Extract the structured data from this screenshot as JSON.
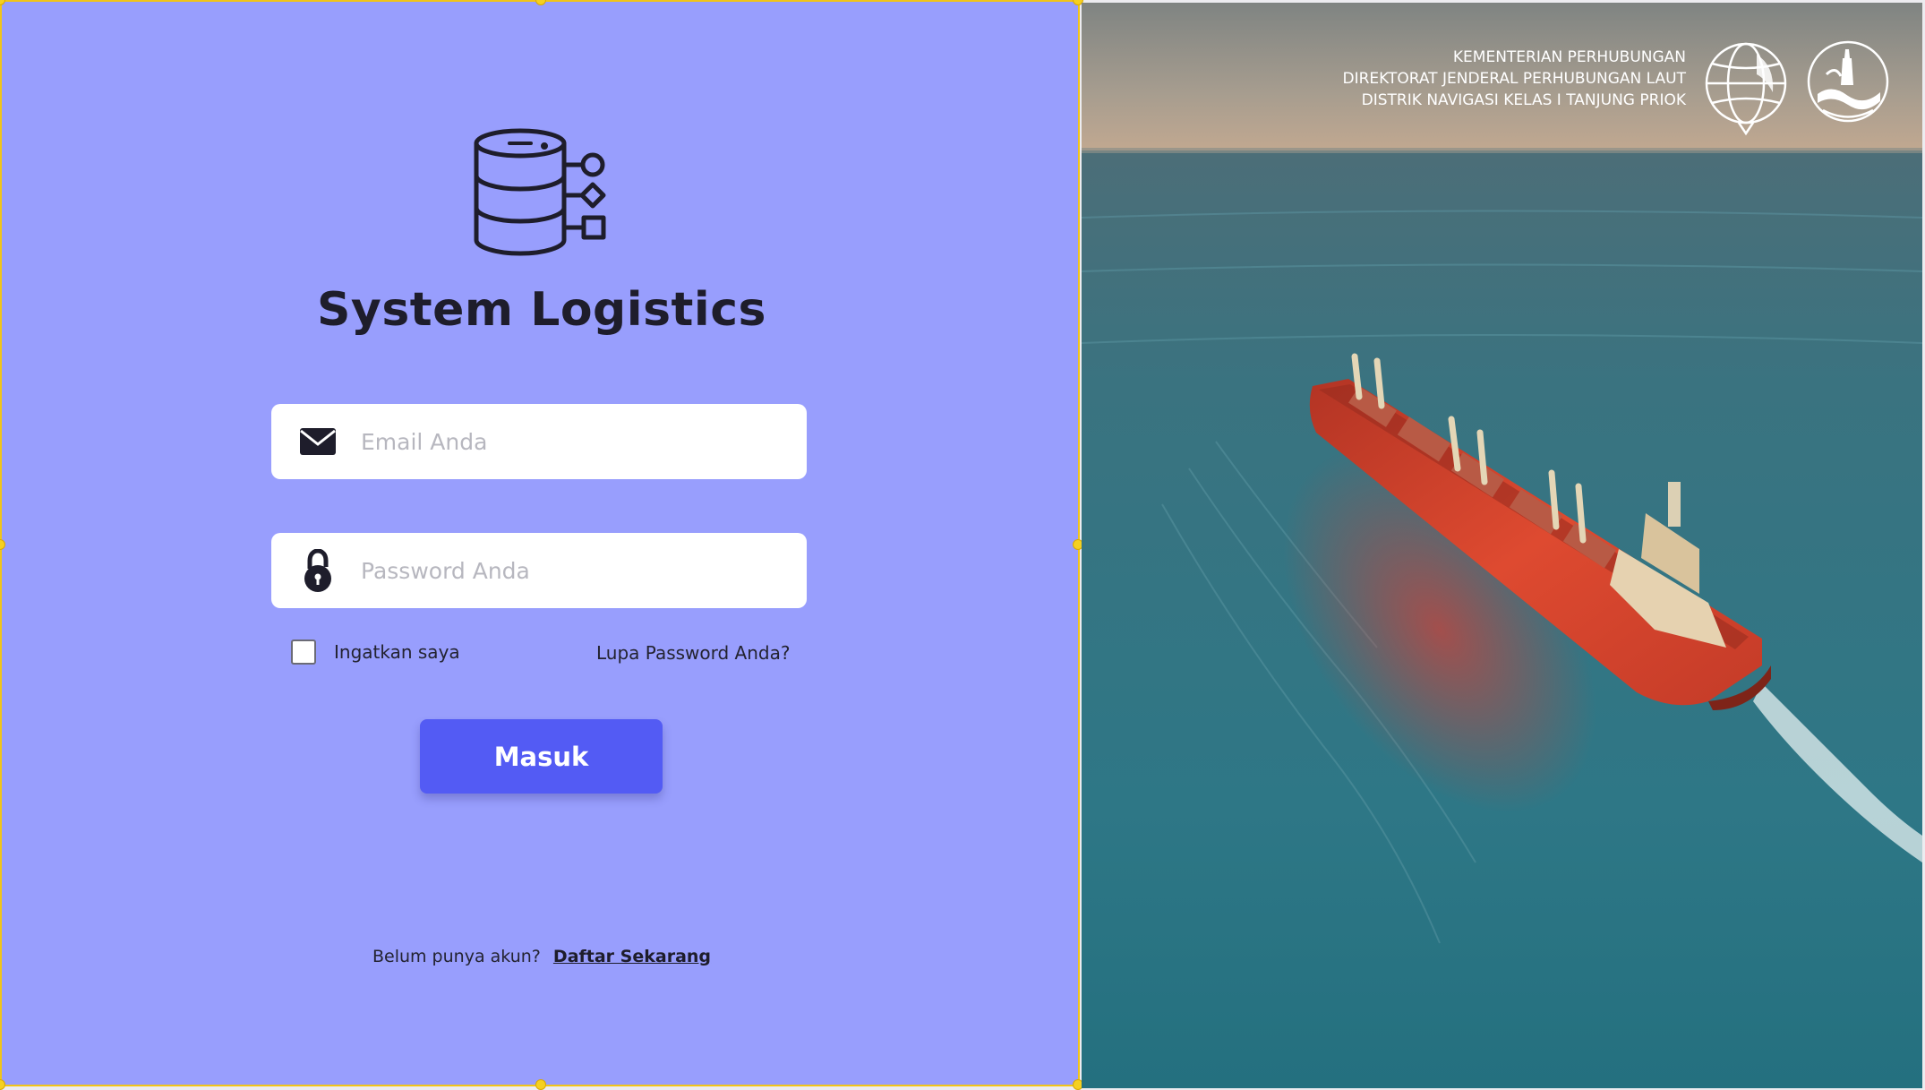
{
  "app": {
    "title": "System Logistics"
  },
  "login": {
    "email_placeholder": "Email Anda",
    "password_placeholder": "Password Anda",
    "remember_label": "Ingatkan saya",
    "forgot_label": "Lupa Password Anda?",
    "submit_label": "Masuk",
    "signup_prompt": "Belum punya akun?",
    "signup_link": "Daftar Sekarang"
  },
  "header": {
    "org_lines": [
      "KEMENTERIAN PERHUBUNGAN",
      "DIREKTORAT JENDERAL PERHUBUNGAN LAUT",
      "DISTRIK NAVIGASI KELAS I TANJUNG PRIOK"
    ]
  },
  "icons": {
    "app": "database-icon",
    "email": "envelope-icon",
    "password": "lock-icon",
    "logo_left": "ministry-globe-logo",
    "logo_right": "navigation-district-logo"
  },
  "colors": {
    "panel_bg": "#989efd",
    "button_bg": "#535bf4",
    "title_text": "#1e1d2b",
    "sea": "#2f7686",
    "ship_hull": "#d8412c"
  }
}
